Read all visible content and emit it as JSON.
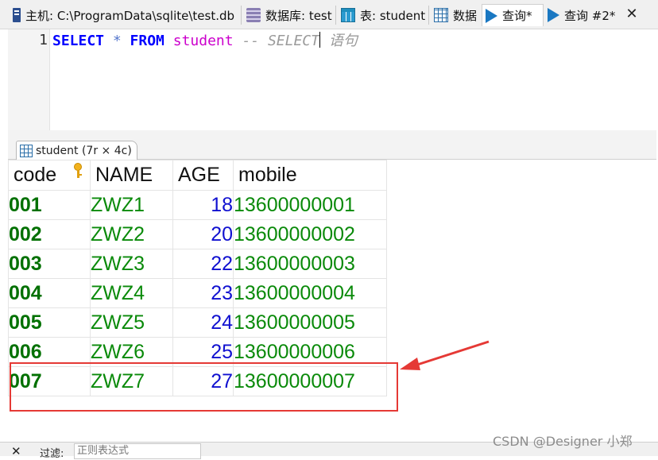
{
  "tabs": [
    {
      "label": "主机: C:\\ProgramData\\sqlite\\test.db",
      "icon": "host-icon"
    },
    {
      "label": "数据库: test",
      "icon": "database-icon"
    },
    {
      "label": "表: student",
      "icon": "table-icon"
    },
    {
      "label": "数据",
      "icon": "data-grid-icon"
    },
    {
      "label": "查询*",
      "icon": "query-play-icon",
      "active": true
    },
    {
      "label": "查询 #2*",
      "icon": "query-play-icon"
    }
  ],
  "close_tab": "✕",
  "editor": {
    "line_number": "1",
    "tokens": {
      "select": "SELECT",
      "star": " * ",
      "from": "FROM",
      "table": " student",
      "comment": " -- SELECT",
      "comment_tail": " 语句"
    }
  },
  "result": {
    "tab_label": "student (7r × 4c)",
    "columns": [
      "code",
      "NAME",
      "AGE",
      "mobile"
    ],
    "rows": [
      [
        "001",
        "ZWZ1",
        "18",
        "13600000001"
      ],
      [
        "002",
        "ZWZ2",
        "20",
        "13600000002"
      ],
      [
        "003",
        "ZWZ3",
        "22",
        "13600000003"
      ],
      [
        "004",
        "ZWZ4",
        "23",
        "13600000004"
      ],
      [
        "005",
        "ZWZ5",
        "24",
        "13600000005"
      ],
      [
        "006",
        "ZWZ6",
        "25",
        "13600000006"
      ],
      [
        "007",
        "ZWZ7",
        "27",
        "13600000007"
      ]
    ],
    "primary_key_icon": "key-icon"
  },
  "colors": {
    "keyword": "#0000ff",
    "identifier": "#cc00cc",
    "code_text": "#007000",
    "text_green": "#0a8a0a",
    "number_blue": "#1010d0",
    "highlight_red": "#e53935"
  },
  "filter": {
    "close": "✕",
    "label": "过滤:",
    "placeholder": "正则表达式"
  },
  "watermark": "CSDN @Designer 小郑"
}
